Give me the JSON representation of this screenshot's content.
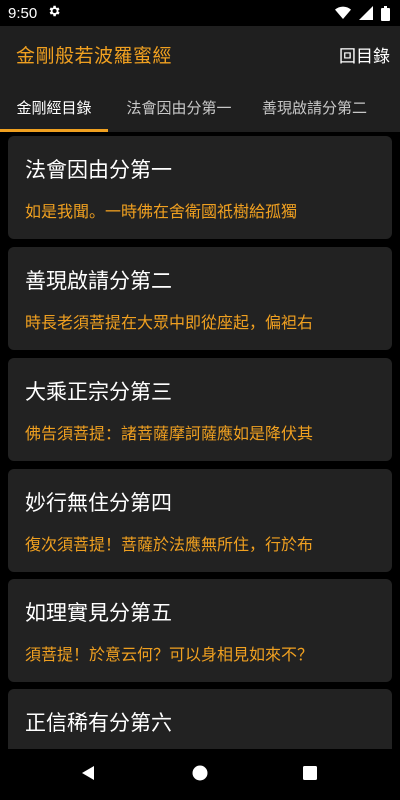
{
  "status": {
    "time": "9:50",
    "icons": [
      "gear-icon",
      "wifi-icon",
      "signal-icon",
      "battery-icon"
    ]
  },
  "app_bar": {
    "title": "金剛般若波羅蜜經",
    "action_label": "回目錄"
  },
  "tabs": [
    {
      "label": "金剛經目錄",
      "active": true
    },
    {
      "label": "法會因由分第一",
      "active": false
    },
    {
      "label": "善現啟請分第二",
      "active": false
    }
  ],
  "chapters": [
    {
      "title": "法會因由分第一",
      "excerpt": "如是我聞。一時佛在舍衛國祇樹給孤獨"
    },
    {
      "title": "善現啟請分第二",
      "excerpt": "時長老須菩提在大眾中即從座起，偏袒右"
    },
    {
      "title": "大乘正宗分第三",
      "excerpt": "佛告須菩提：諸菩薩摩訶薩應如是降伏其"
    },
    {
      "title": "妙行無住分第四",
      "excerpt": "復次須菩提！菩薩於法應無所住，行於布"
    },
    {
      "title": "如理實見分第五",
      "excerpt": "須菩提！於意云何？可以身相見如來不？"
    },
    {
      "title": "正信稀有分第六",
      "excerpt": ""
    }
  ],
  "colors": {
    "accent": "#f0a020",
    "app_bar_bg": "#1f1f1f",
    "card_bg": "#222222",
    "background": "#000000"
  },
  "nav": {
    "icons": [
      "back-icon",
      "home-icon",
      "recents-icon"
    ]
  }
}
